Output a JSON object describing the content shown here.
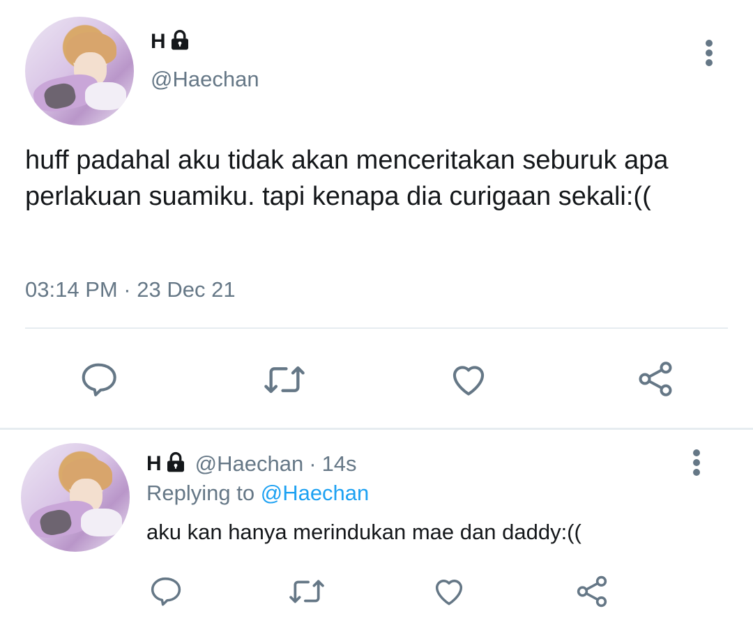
{
  "main_tweet": {
    "display_name": "H",
    "handle": "@Haechan",
    "text": "huff padahal aku tidak akan menceritakan seburuk apa perlakuan suamiku. tapi kenapa dia curigaan sekali:((",
    "timestamp": "03:14 PM · 23 Dec 21",
    "avatar_icon": "profile-photo",
    "actions": [
      "reply-icon",
      "retweet-icon",
      "like-icon",
      "share-icon"
    ]
  },
  "reply_tweet": {
    "display_name": "H",
    "handle": "@Haechan",
    "separator": "·",
    "time_ago": "14s",
    "replying_prefix": "Replying to",
    "replying_to": "@Haechan",
    "text": "aku kan hanya merindukan mae dan daddy:((",
    "actions": [
      "reply-icon",
      "retweet-icon",
      "like-icon",
      "share-icon"
    ]
  },
  "colors": {
    "text": "#14171a",
    "secondary": "#657786",
    "link": "#1da1f2",
    "divider": "#e6ecf0"
  }
}
